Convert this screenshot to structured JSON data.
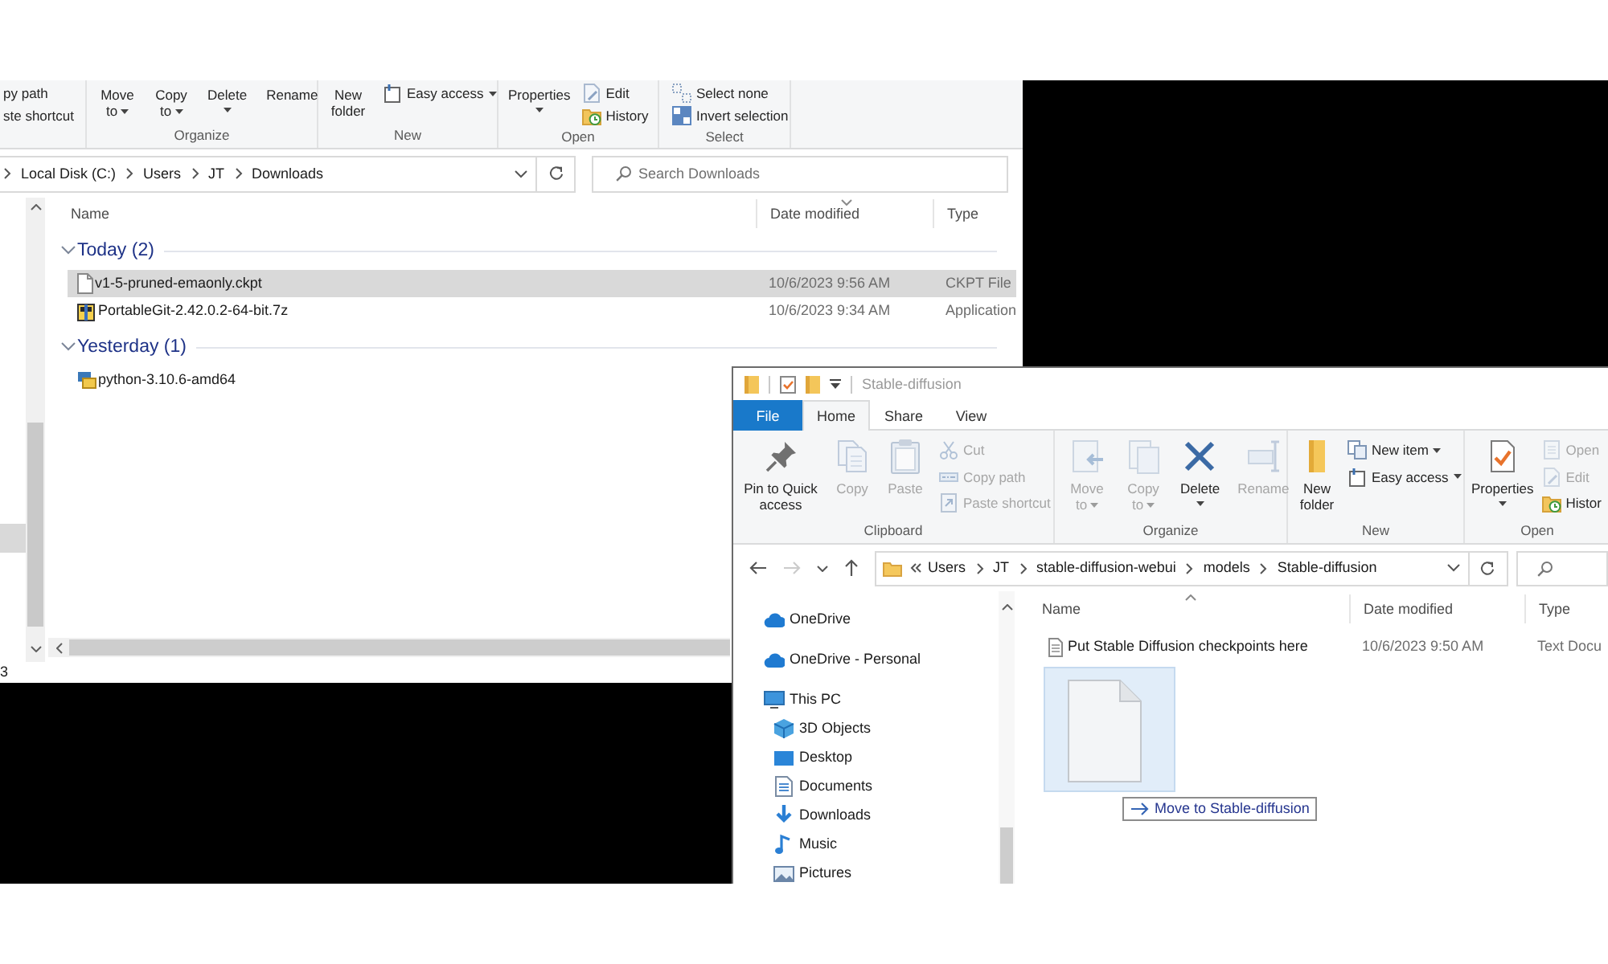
{
  "left_window": {
    "ribbon": {
      "groups": [
        {
          "buttons": [
            {
              "kind": "plain",
              "label": "py path",
              "dropdown": false,
              "disabled": false
            },
            {
              "kind": "plain",
              "label": "ste shortcut",
              "dropdown": false,
              "disabled": false
            }
          ]
        },
        {
          "label": "Organize",
          "buttons": [
            {
              "kind": "tall",
              "label": "Move to",
              "dropdown": true,
              "disabled": false
            },
            {
              "kind": "tall",
              "label": "Copy to",
              "dropdown": true,
              "disabled": false
            },
            {
              "kind": "tall",
              "label": "Delete",
              "dropdown": true,
              "disabled": false
            },
            {
              "kind": "tall",
              "label": "Rename",
              "dropdown": false,
              "disabled": false
            }
          ]
        },
        {
          "label": "New",
          "buttons": [
            {
              "kind": "tall",
              "label": "New folder",
              "dropdown": false,
              "disabled": false
            },
            {
              "kind": "small",
              "label": "Easy access",
              "dropdown": true,
              "disabled": false
            }
          ]
        },
        {
          "label": "Open",
          "buttons": [
            {
              "kind": "tall",
              "label": "Properties",
              "dropdown": true,
              "disabled": false
            },
            {
              "kind": "small",
              "label": "Edit",
              "dropdown": false,
              "disabled": false
            },
            {
              "kind": "small",
              "label": "History",
              "dropdown": false,
              "disabled": false
            }
          ]
        },
        {
          "label": "Select",
          "buttons": [
            {
              "kind": "small",
              "label": "Select none",
              "dropdown": false,
              "disabled": false
            },
            {
              "kind": "small",
              "label": "Invert selection",
              "dropdown": false,
              "disabled": false
            }
          ]
        }
      ]
    },
    "address": {
      "overflow": false,
      "path": [
        "Local Disk (C:)",
        "Users",
        "JT",
        "Downloads"
      ]
    },
    "search": {
      "placeholder": "Search Downloads"
    },
    "columns": [
      {
        "label": "Name",
        "sorted": false
      },
      {
        "label": "Date modified",
        "sorted": true,
        "descending": true
      },
      {
        "label": "Type",
        "sorted": false
      }
    ],
    "groups": [
      {
        "label": "Today (2)",
        "expanded": true,
        "files": [
          {
            "name": "v1-5-pruned-emaonly.ckpt",
            "date": "10/6/2023 9:56 AM",
            "type": "CKPT File",
            "selected": true
          },
          {
            "name": "PortableGit-2.42.0.2-64-bit.7z",
            "date": "10/6/2023 9:34 AM",
            "type": "Application",
            "selected": false
          }
        ]
      },
      {
        "label": "Yesterday (1)",
        "expanded": true,
        "files": [
          {
            "name": "python-3.10.6-amd64",
            "selected": false
          }
        ]
      }
    ],
    "status": "3"
  },
  "right_window": {
    "title": "Stable-diffusion",
    "tabs": [
      {
        "kind": "file",
        "label": "File",
        "selected": false
      },
      {
        "kind": "tab",
        "label": "Home",
        "selected": true
      },
      {
        "kind": "tab",
        "label": "Share",
        "selected": false
      },
      {
        "kind": "tab",
        "label": "View",
        "selected": false
      }
    ],
    "ribbon": {
      "groups": [
        {
          "label": "Clipboard",
          "buttons": [
            {
              "kind": "large",
              "label": "Pin to Quick access",
              "dropdown": false,
              "disabled": false
            },
            {
              "kind": "large",
              "label": "Copy",
              "dropdown": false,
              "disabled": true
            },
            {
              "kind": "large",
              "label": "Paste",
              "dropdown": false,
              "disabled": true
            },
            {
              "kind": "small",
              "label": "Cut",
              "dropdown": false,
              "disabled": true
            },
            {
              "kind": "small",
              "label": "Copy path",
              "dropdown": false,
              "disabled": true
            },
            {
              "kind": "small",
              "label": "Paste shortcut",
              "dropdown": false,
              "disabled": true
            }
          ]
        },
        {
          "label": "Organize",
          "buttons": [
            {
              "kind": "large",
              "label": "Move to",
              "dropdown": true,
              "disabled": true
            },
            {
              "kind": "large",
              "label": "Copy to",
              "dropdown": true,
              "disabled": true
            },
            {
              "kind": "large",
              "label": "Delete",
              "dropdown": true,
              "disabled": false
            },
            {
              "kind": "large",
              "label": "Rename",
              "dropdown": false,
              "disabled": true
            }
          ]
        },
        {
          "label": "New",
          "buttons": [
            {
              "kind": "large",
              "label": "New folder",
              "dropdown": false,
              "disabled": false
            },
            {
              "kind": "small",
              "label": "New item",
              "dropdown": true,
              "disabled": false
            },
            {
              "kind": "small",
              "label": "Easy access",
              "dropdown": true,
              "disabled": false
            }
          ]
        },
        {
          "label": "Open",
          "buttons": [
            {
              "kind": "large",
              "label": "Properties",
              "dropdown": true,
              "disabled": false
            },
            {
              "kind": "small",
              "label": "Open",
              "dropdown": false,
              "disabled": true
            },
            {
              "kind": "small",
              "label": "Edit",
              "dropdown": false,
              "disabled": true
            },
            {
              "kind": "small",
              "label": "Histor",
              "dropdown": false,
              "disabled": false
            }
          ]
        }
      ]
    },
    "nav_buttons": [
      {
        "disabled": false
      },
      {
        "disabled": true
      },
      {
        "disabled": false
      },
      {
        "disabled": false
      }
    ],
    "address": {
      "overflow": true,
      "path": [
        "Users",
        "JT",
        "stable-diffusion-webui",
        "models",
        "Stable-diffusion"
      ]
    },
    "nav_pane": {
      "items": [
        {
          "label": "OneDrive"
        },
        {
          "label": "OneDrive - Personal"
        },
        {
          "label": "This PC",
          "children": [
            {
              "label": "3D Objects"
            },
            {
              "label": "Desktop"
            },
            {
              "label": "Documents"
            },
            {
              "label": "Downloads"
            },
            {
              "label": "Music"
            },
            {
              "label": "Pictures"
            }
          ]
        }
      ]
    },
    "columns": [
      {
        "label": "Name",
        "sorted": true,
        "descending": false
      },
      {
        "label": "Date modified",
        "sorted": false
      },
      {
        "label": "Type",
        "sorted": false
      }
    ],
    "files": [
      {
        "name": "Put Stable Diffusion checkpoints here",
        "date": "10/6/2023 9:50 AM",
        "type": "Text Docu",
        "selected": false
      }
    ],
    "drag": {
      "tooltip": "Move to Stable-diffusion"
    }
  }
}
